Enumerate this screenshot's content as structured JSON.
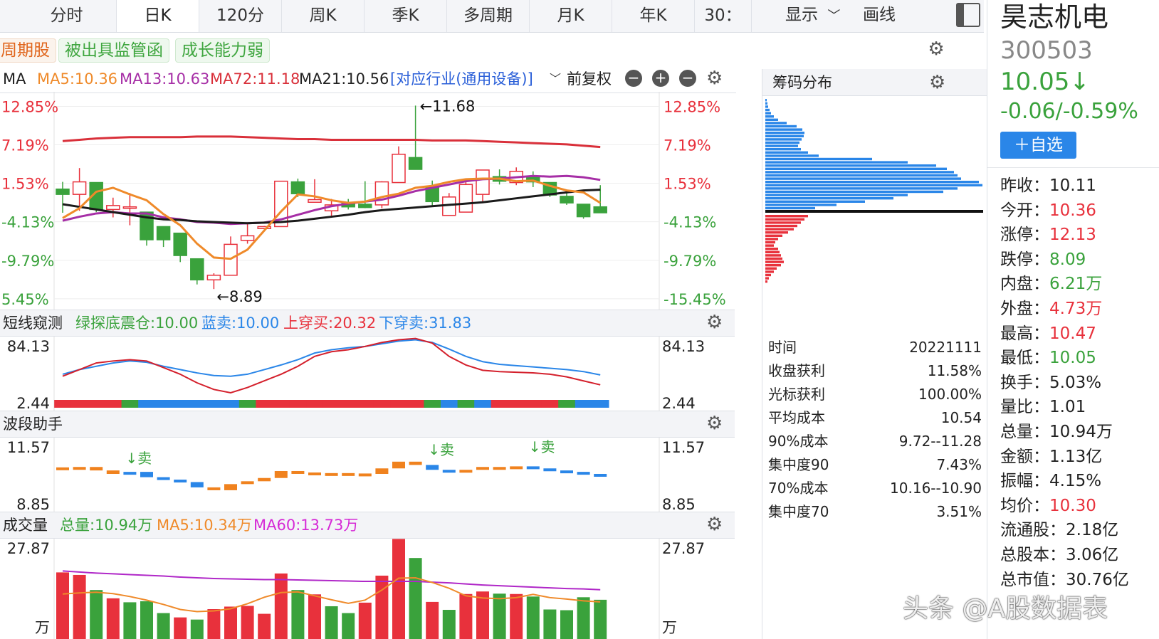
{
  "colors": {
    "up": "#e8313c",
    "down": "#3aa23c",
    "ma5": "#ef8a2a",
    "ma13": "#a62ea6",
    "ma72": "#d9303a",
    "ma21": "#1a1a1a",
    "blue": "#2a86e8",
    "purple": "#b028c8"
  },
  "tabs": [
    "分时",
    "日K",
    "120分",
    "周K",
    "季K",
    "多周期",
    "月K",
    "年K",
    "30："
  ],
  "active_tab": "日K",
  "toolbar": {
    "display_label": "显示",
    "draw_label": "画线"
  },
  "tags": [
    "周期股",
    "被出具监管函",
    "成长能力弱"
  ],
  "ma_header": {
    "name": "MA",
    "ma5": "MA5:10.36",
    "ma13": "MA13:10.63",
    "ma72": "MA72:11.18",
    "ma21": "MA21:10.56",
    "industry": "[对应行业(通用设备)]",
    "adjust": "前复权"
  },
  "kline_axis": [
    "12.85%",
    "7.19%",
    "1.53%",
    "-4.13%",
    "-9.79%",
    "-15.45%"
  ],
  "kline_axis_left": [
    "12.85%",
    "7.19%",
    "1.53%",
    "-4.13%",
    "-9.79%",
    "5.45%"
  ],
  "kline_marks": {
    "high": "←11.68",
    "low": "←8.89"
  },
  "short_header": {
    "title": "短线窥测",
    "a": "绿探底震仓:10.00",
    "b": "蓝卖:10.00",
    "c": "上穿买:20.32",
    "d": "下穿卖:31.83"
  },
  "short_axis": [
    "84.13",
    "2.44"
  ],
  "wave_header": {
    "title": "波段助手"
  },
  "wave_axis": [
    "11.57",
    "8.85"
  ],
  "wave_marks": [
    "↓卖",
    "↓卖",
    "↓卖"
  ],
  "vol_header": {
    "title": "成交量",
    "total": "总量:10.94万",
    "ma5": "MA5:10.34万",
    "ma60": "MA60:13.73万"
  },
  "vol_axis": [
    "27.87",
    "万"
  ],
  "chip": {
    "title": "筹码分布",
    "rows": [
      {
        "k": "时间",
        "v": "20221111"
      },
      {
        "k": "收盘获利",
        "v": "11.58%"
      },
      {
        "k": "光标获利",
        "v": "100.00%"
      },
      {
        "k": "平均成本",
        "v": "10.54"
      },
      {
        "k": "90%成本",
        "v": "9.72--11.28"
      },
      {
        "k": "集中度90",
        "v": "7.43%"
      },
      {
        "k": "70%成本",
        "v": "10.16--10.90"
      },
      {
        "k": "集中度70",
        "v": "3.51%"
      }
    ]
  },
  "quote": {
    "name": "昊志机电",
    "code": "300503",
    "price": "10.05↓",
    "change": "-0.06/-0.59%",
    "watch_button": "＋自选",
    "items": [
      {
        "k": "昨收：",
        "v": "10.11",
        "c": "#222"
      },
      {
        "k": "今开：",
        "v": "10.36",
        "c": "#e8313c"
      },
      {
        "k": "涨停：",
        "v": "12.13",
        "c": "#e8313c"
      },
      {
        "k": "跌停：",
        "v": "8.09",
        "c": "#3aa23c"
      },
      {
        "k": "内盘：",
        "v": "6.21万",
        "c": "#3aa23c"
      },
      {
        "k": "外盘：",
        "v": "4.73万",
        "c": "#e8313c"
      },
      {
        "k": "最高：",
        "v": "10.47",
        "c": "#e8313c"
      },
      {
        "k": "最低：",
        "v": "10.05",
        "c": "#3aa23c"
      },
      {
        "k": "换手：",
        "v": "5.03%",
        "c": "#222"
      },
      {
        "k": "量比：",
        "v": "1.01",
        "c": "#222"
      },
      {
        "k": "总量：",
        "v": "10.94万",
        "c": "#222"
      },
      {
        "k": "金额：",
        "v": "1.13亿",
        "c": "#222"
      },
      {
        "k": "振幅：",
        "v": "4.15%",
        "c": "#222"
      },
      {
        "k": "均价：",
        "v": "10.30",
        "c": "#e8313c"
      },
      {
        "k": "流通股：",
        "v": "2.18亿",
        "c": "#222"
      },
      {
        "k": "总股本：",
        "v": "3.06亿",
        "c": "#222"
      },
      {
        "k": "总市值：",
        "v": "30.76亿",
        "c": "#222"
      }
    ]
  },
  "watermark": "头条 @A股数据表",
  "chart_data": {
    "type": "candlestick",
    "unit": "price (CNY)",
    "ylim": [
      8.73,
      11.76
    ],
    "candles": [
      {
        "o": 10.41,
        "h": 10.52,
        "l": 10.05,
        "c": 10.33
      },
      {
        "o": 10.33,
        "h": 10.73,
        "l": 10.08,
        "c": 10.52
      },
      {
        "o": 10.51,
        "h": 10.51,
        "l": 10.06,
        "c": 10.1
      },
      {
        "o": 10.1,
        "h": 10.28,
        "l": 9.98,
        "c": 10.16
      },
      {
        "o": 10.14,
        "h": 10.35,
        "l": 9.86,
        "c": 10.14
      },
      {
        "o": 10.06,
        "h": 10.06,
        "l": 9.55,
        "c": 9.64
      },
      {
        "o": 9.84,
        "h": 9.84,
        "l": 9.53,
        "c": 9.64
      },
      {
        "o": 9.74,
        "h": 9.74,
        "l": 9.3,
        "c": 9.4
      },
      {
        "o": 9.35,
        "h": 9.35,
        "l": 8.96,
        "c": 9.03
      },
      {
        "o": 9.03,
        "h": 9.13,
        "l": 8.89,
        "c": 9.1
      },
      {
        "o": 9.1,
        "h": 9.69,
        "l": 9.1,
        "c": 9.57
      },
      {
        "o": 9.63,
        "h": 9.89,
        "l": 9.58,
        "c": 9.7
      },
      {
        "o": 9.81,
        "h": 9.85,
        "l": 9.8,
        "c": 9.84
      },
      {
        "o": 9.84,
        "h": 10.53,
        "l": 9.84,
        "c": 10.53
      },
      {
        "o": 10.52,
        "h": 10.57,
        "l": 10.29,
        "c": 10.34
      },
      {
        "o": 10.21,
        "h": 10.56,
        "l": 10.21,
        "c": 10.25
      },
      {
        "o": 10.08,
        "h": 10.26,
        "l": 9.98,
        "c": 10.17
      },
      {
        "o": 10.2,
        "h": 10.26,
        "l": 10.1,
        "c": 10.14
      },
      {
        "o": 10.18,
        "h": 10.53,
        "l": 10.12,
        "c": 10.13
      },
      {
        "o": 10.17,
        "h": 10.53,
        "l": 10.12,
        "c": 10.52
      },
      {
        "o": 10.51,
        "h": 11.06,
        "l": 10.51,
        "c": 10.94
      },
      {
        "o": 10.89,
        "h": 11.68,
        "l": 10.71,
        "c": 10.71
      },
      {
        "o": 10.44,
        "h": 10.54,
        "l": 10.14,
        "c": 10.22
      },
      {
        "o": 10.01,
        "h": 10.35,
        "l": 10.01,
        "c": 10.29
      },
      {
        "o": 10.06,
        "h": 10.52,
        "l": 10.06,
        "c": 10.48
      },
      {
        "o": 10.33,
        "h": 10.7,
        "l": 10.22,
        "c": 10.7
      },
      {
        "o": 10.6,
        "h": 10.71,
        "l": 10.48,
        "c": 10.53
      },
      {
        "o": 10.51,
        "h": 10.74,
        "l": 10.47,
        "c": 10.68
      },
      {
        "o": 10.6,
        "h": 10.68,
        "l": 10.44,
        "c": 10.52
      },
      {
        "o": 10.51,
        "h": 10.51,
        "l": 10.29,
        "c": 10.32
      },
      {
        "o": 10.3,
        "h": 10.38,
        "l": 10.17,
        "c": 10.2
      },
      {
        "o": 10.18,
        "h": 10.18,
        "l": 9.96,
        "c": 9.99
      },
      {
        "o": 10.14,
        "h": 10.47,
        "l": 10.05,
        "c": 10.05
      }
    ],
    "ma5": [
      9.97,
      10.12,
      10.37,
      10.43,
      10.33,
      10.24,
      10.03,
      9.86,
      9.58,
      9.37,
      9.35,
      9.49,
      9.78,
      10.07,
      10.33,
      10.3,
      10.24,
      10.2,
      10.22,
      10.29,
      10.34,
      10.43,
      10.46,
      10.52,
      10.56,
      10.57,
      10.57,
      10.53,
      10.54,
      10.46,
      10.39,
      10.36,
      10.2
    ],
    "ma13": [
      9.93,
      9.99,
      10.04,
      10.06,
      10.04,
      10.04,
      9.98,
      9.95,
      9.91,
      9.9,
      9.88,
      9.89,
      9.9,
      9.95,
      10.02,
      10.09,
      10.15,
      10.19,
      10.22,
      10.25,
      10.31,
      10.38,
      10.43,
      10.48,
      10.53,
      10.56,
      10.57,
      10.59,
      10.61,
      10.6,
      10.61,
      10.59,
      10.55
    ],
    "ma72": [
      11.14,
      11.16,
      11.18,
      11.19,
      11.2,
      11.2,
      11.2,
      11.2,
      11.21,
      11.21,
      11.21,
      11.2,
      11.19,
      11.18,
      11.17,
      11.17,
      11.16,
      11.16,
      11.16,
      11.16,
      11.16,
      11.16,
      11.15,
      11.15,
      11.15,
      11.14,
      11.13,
      11.12,
      11.11,
      11.1,
      11.09,
      11.07,
      11.05
    ],
    "ma21": [
      10.18,
      10.14,
      10.1,
      10.06,
      10.02,
      9.98,
      9.95,
      9.94,
      9.92,
      9.91,
      9.9,
      9.89,
      9.9,
      9.91,
      9.93,
      9.96,
      9.99,
      10.02,
      10.06,
      10.09,
      10.11,
      10.13,
      10.15,
      10.17,
      10.19,
      10.21,
      10.24,
      10.27,
      10.3,
      10.33,
      10.36,
      10.39,
      10.4
    ],
    "short_term": {
      "ylim": [
        2.44,
        84.13
      ],
      "red": [
        35,
        45,
        55,
        58,
        60,
        58,
        48,
        38,
        25,
        15,
        10,
        18,
        28,
        38,
        50,
        65,
        72,
        75,
        80,
        86,
        90,
        92,
        85,
        65,
        52,
        44,
        42,
        41,
        40,
        38,
        34,
        28,
        22
      ],
      "blue": [
        38,
        45,
        50,
        55,
        58,
        56,
        50,
        45,
        40,
        36,
        35,
        38,
        45,
        52,
        60,
        70,
        75,
        78,
        80,
        84,
        88,
        90,
        86,
        76,
        65,
        57,
        53,
        51,
        49,
        47,
        45,
        42,
        37
      ],
      "state_bar": [
        "red",
        "red",
        "red",
        "red",
        "green",
        "blue",
        "blue",
        "blue",
        "blue",
        "blue",
        "blue",
        "green",
        "red",
        "red",
        "red",
        "red",
        "red",
        "red",
        "red",
        "red",
        "red",
        "red",
        "green",
        "blue",
        "green",
        "blue",
        "red",
        "red",
        "red",
        "red",
        "green",
        "blue",
        "blue"
      ]
    },
    "wave": {
      "ylim": [
        8.85,
        11.57
      ],
      "values": [
        10.55,
        10.62,
        10.45,
        10.28,
        10.38,
        10.12,
        10.0,
        9.88,
        9.62,
        9.48,
        9.78,
        9.92,
        10.08,
        10.42,
        10.35,
        10.28,
        10.32,
        10.3,
        10.28,
        10.55,
        10.88,
        10.72,
        10.48,
        10.35,
        10.48,
        10.62,
        10.58,
        10.65,
        10.55,
        10.45,
        10.38,
        10.28,
        10.26
      ],
      "sign": [
        1,
        1,
        1,
        1,
        -1,
        -1,
        -1,
        -1,
        -1,
        1,
        1,
        1,
        1,
        1,
        1,
        1,
        1,
        1,
        1,
        1,
        1,
        1,
        -1,
        -1,
        1,
        1,
        1,
        1,
        -1,
        -1,
        -1,
        -1,
        -1
      ]
    },
    "volume": {
      "ylim": [
        0,
        27.87
      ],
      "unit": "万",
      "values": [
        18.5,
        17.8,
        13.6,
        11.3,
        10.2,
        10.5,
        7.2,
        6.0,
        5.4,
        8.3,
        9.0,
        9.2,
        7.0,
        18.2,
        13.6,
        12.4,
        9.1,
        7.2,
        10.1,
        17.6,
        27.8,
        22.5,
        10.3,
        8.1,
        12.5,
        13.2,
        12.6,
        12.5,
        11.8,
        8.2,
        8.0,
        11.6,
        10.9
      ],
      "up": [
        1,
        1,
        0,
        1,
        0,
        0,
        0,
        1,
        0,
        1,
        1,
        1,
        1,
        1,
        0,
        1,
        0,
        0,
        1,
        1,
        1,
        0,
        1,
        0,
        1,
        1,
        0,
        1,
        0,
        0,
        0,
        0,
        0
      ],
      "ma5": [
        12.5,
        12.8,
        13.0,
        12.6,
        11.8,
        10.8,
        9.6,
        8.2,
        7.6,
        7.8,
        8.4,
        9.8,
        11.6,
        12.9,
        13.1,
        12.0,
        10.9,
        9.9,
        10.8,
        13.6,
        16.9,
        17.0,
        15.7,
        14.1,
        12.0,
        11.4,
        11.2,
        11.5,
        12.4,
        11.5,
        11.1,
        10.6,
        10.3
      ],
      "ma60": [
        18.9,
        18.6,
        18.3,
        18.1,
        17.9,
        17.7,
        17.5,
        17.2,
        17.0,
        16.8,
        16.7,
        16.6,
        16.5,
        16.5,
        16.4,
        16.3,
        16.2,
        16.1,
        16.0,
        16.0,
        16.0,
        16.0,
        15.8,
        15.6,
        15.3,
        15.0,
        14.8,
        14.6,
        14.4,
        14.2,
        14.0,
        13.9,
        13.7
      ]
    },
    "chip_profile": {
      "price_levels_note": "profit (red, below close) / trapped (blue, above close)",
      "blue": [
        2,
        3,
        4,
        6,
        8,
        12,
        18,
        30,
        44,
        52,
        55,
        54,
        51,
        48,
        46,
        50,
        60,
        75,
        150,
        200,
        240,
        255,
        265,
        270,
        275,
        300,
        305,
        270,
        250,
        200,
        180,
        140,
        100,
        70,
        45
      ],
      "red": [
        60,
        55,
        50,
        45,
        40,
        32,
        24,
        18,
        14,
        12,
        18,
        20,
        22,
        24,
        26,
        22,
        16,
        12,
        8,
        5,
        3
      ]
    }
  }
}
